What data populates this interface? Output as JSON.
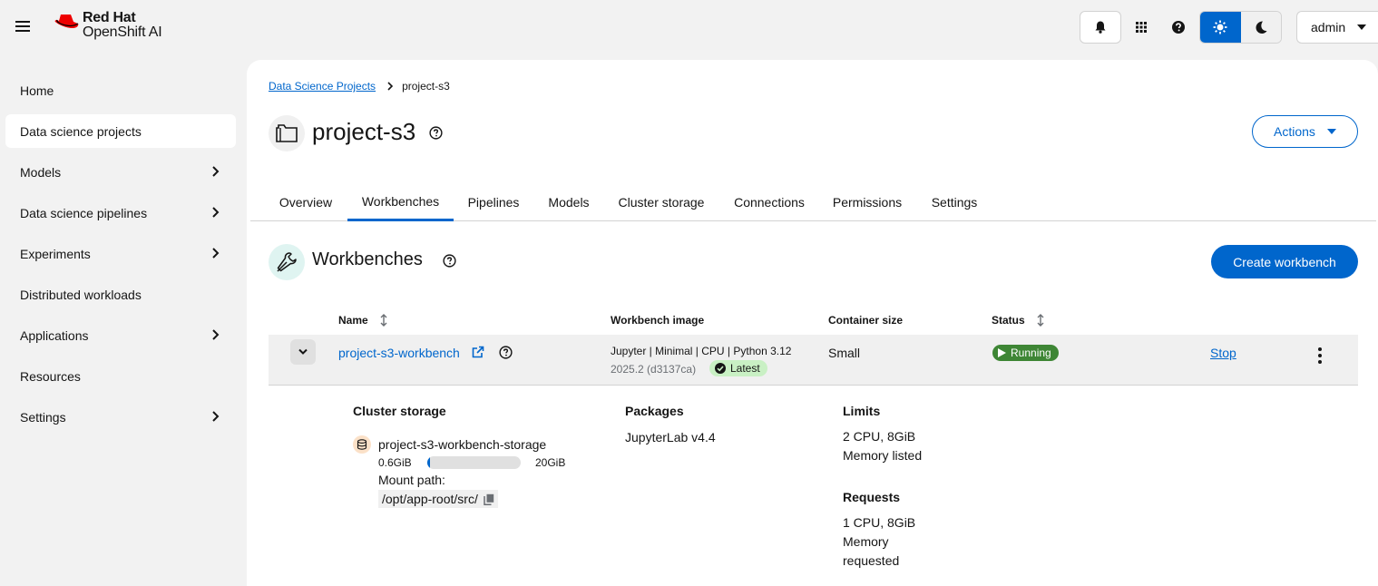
{
  "header": {
    "brand_line1": "Red Hat",
    "brand_line2": "OpenShift AI",
    "user": "admin"
  },
  "sidebar": {
    "items": [
      {
        "label": "Home",
        "has_children": false
      },
      {
        "label": "Data science projects",
        "has_children": false,
        "active": true
      },
      {
        "label": "Models",
        "has_children": true
      },
      {
        "label": "Data science pipelines",
        "has_children": true
      },
      {
        "label": "Experiments",
        "has_children": true
      },
      {
        "label": "Distributed workloads",
        "has_children": false
      },
      {
        "label": "Applications",
        "has_children": true
      },
      {
        "label": "Resources",
        "has_children": false
      },
      {
        "label": "Settings",
        "has_children": true
      }
    ]
  },
  "breadcrumb": {
    "parent": "Data Science Projects",
    "current": "project-s3"
  },
  "project": {
    "title": "project-s3",
    "actions_label": "Actions"
  },
  "tabs": [
    {
      "label": "Overview"
    },
    {
      "label": "Workbenches",
      "active": true
    },
    {
      "label": "Pipelines"
    },
    {
      "label": "Models"
    },
    {
      "label": "Cluster storage"
    },
    {
      "label": "Connections"
    },
    {
      "label": "Permissions"
    },
    {
      "label": "Settings"
    }
  ],
  "workbenches": {
    "title": "Workbenches",
    "create_label": "Create workbench",
    "columns": {
      "name": "Name",
      "image": "Workbench image",
      "size": "Container size",
      "status": "Status"
    },
    "row": {
      "name": "project-s3-workbench",
      "image": "Jupyter | Minimal | CPU | Python 3.12",
      "image_version": "2025.2 (d3137ca)",
      "image_badge": "Latest",
      "size": "Small",
      "status": "Running",
      "stop_label": "Stop"
    },
    "details": {
      "storage_heading": "Cluster storage",
      "storage_name": "project-s3-workbench-storage",
      "storage_used": "0.6GiB",
      "storage_total": "20GiB",
      "storage_fraction": 0.03,
      "mount_label": "Mount path:",
      "mount_path": "/opt/app-root/src/",
      "packages_heading": "Packages",
      "package": "JupyterLab v4.4",
      "limits_heading": "Limits",
      "limits_line1": "2 CPU, 8GiB",
      "limits_line2": "Memory listed",
      "requests_heading": "Requests",
      "requests_line1": "1 CPU, 8GiB",
      "requests_line2": "Memory",
      "requests_line3": "requested"
    }
  },
  "colors": {
    "accent": "#0066cc",
    "running": "#3e8635",
    "latest_badge": "#c9f0c4"
  }
}
